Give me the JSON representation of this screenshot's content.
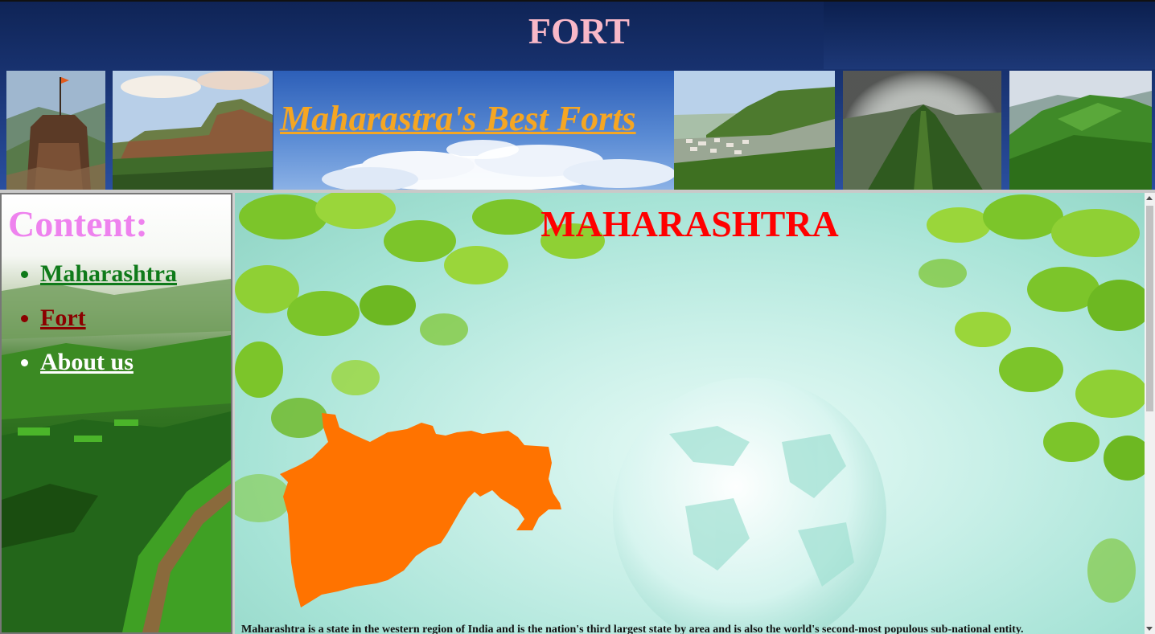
{
  "header": {
    "site_title": "FORT",
    "banner_title": "Maharastra's Best Forts",
    "images": [
      "fort-tower-photo",
      "cliff-fort-photo",
      "town-hill-photo",
      "ridge-trail-photo",
      "green-hill-photo"
    ]
  },
  "sidebar": {
    "heading": "Content:",
    "items": [
      {
        "label": "Maharashtra",
        "color": "#0f7a1a"
      },
      {
        "label": "Fort",
        "color": "#8b0000"
      },
      {
        "label": "About us",
        "color": "#ffffff"
      }
    ]
  },
  "main": {
    "title": "MAHARASHTRA",
    "intro": "Maharashtra is a state in the western region of India and is the nation's third largest state by area and is also the world's second-most populous sub-national entity.",
    "map_color": "#ff7300"
  },
  "colors": {
    "site_title": "#f9b8c8",
    "banner_title": "#f5a623",
    "content_heading": "#ee82ee",
    "main_title": "#ff0000"
  }
}
